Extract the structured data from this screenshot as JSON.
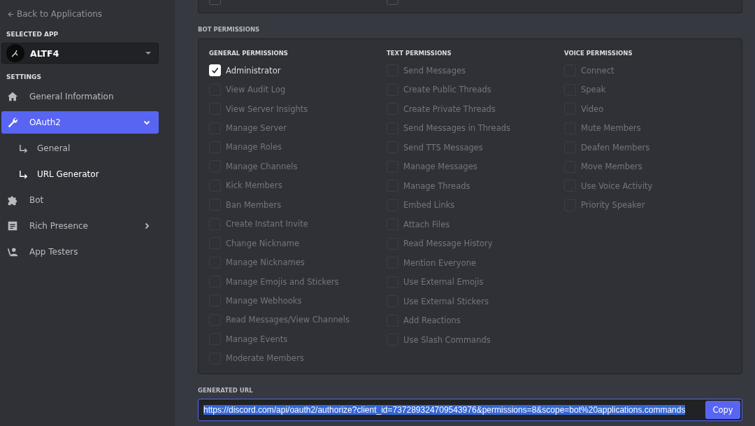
{
  "sidebar": {
    "back_link": "Back to Applications",
    "selected_app_label": "SELECTED APP",
    "app": {
      "name": "ALTF4"
    },
    "settings_label": "SETTINGS",
    "items": [
      {
        "label": "General Information",
        "kind": "link",
        "selected": false
      },
      {
        "label": "OAuth2",
        "kind": "group",
        "selected": true,
        "expanded": true,
        "children": [
          {
            "label": "General",
            "selected": false
          },
          {
            "label": "URL Generator",
            "selected": true
          }
        ]
      },
      {
        "label": "Bot",
        "kind": "link",
        "selected": false
      },
      {
        "label": "Rich Presence",
        "kind": "group",
        "selected": false,
        "expanded": false
      },
      {
        "label": "App Testers",
        "kind": "link",
        "selected": false
      }
    ]
  },
  "top_panel": {
    "checkboxes": [
      {
        "checked": false
      },
      {
        "checked": false
      }
    ]
  },
  "bot_permissions": {
    "title": "BOT PERMISSIONS",
    "columns": [
      {
        "title": "GENERAL PERMISSIONS",
        "items": [
          {
            "label": "Administrator",
            "checked": true,
            "disabled": false
          },
          {
            "label": "View Audit Log",
            "checked": false,
            "disabled": true
          },
          {
            "label": "View Server Insights",
            "checked": false,
            "disabled": true
          },
          {
            "label": "Manage Server",
            "checked": false,
            "disabled": true
          },
          {
            "label": "Manage Roles",
            "checked": false,
            "disabled": true
          },
          {
            "label": "Manage Channels",
            "checked": false,
            "disabled": true
          },
          {
            "label": "Kick Members",
            "checked": false,
            "disabled": true
          },
          {
            "label": "Ban Members",
            "checked": false,
            "disabled": true
          },
          {
            "label": "Create Instant Invite",
            "checked": false,
            "disabled": true
          },
          {
            "label": "Change Nickname",
            "checked": false,
            "disabled": true
          },
          {
            "label": "Manage Nicknames",
            "checked": false,
            "disabled": true
          },
          {
            "label": "Manage Emojis and Stickers",
            "checked": false,
            "disabled": true
          },
          {
            "label": "Manage Webhooks",
            "checked": false,
            "disabled": true
          },
          {
            "label": "Read Messages/View Channels",
            "checked": false,
            "disabled": true
          },
          {
            "label": "Manage Events",
            "checked": false,
            "disabled": true
          },
          {
            "label": "Moderate Members",
            "checked": false,
            "disabled": true
          }
        ]
      },
      {
        "title": "TEXT PERMISSIONS",
        "items": [
          {
            "label": "Send Messages",
            "checked": false,
            "disabled": true
          },
          {
            "label": "Create Public Threads",
            "checked": false,
            "disabled": true
          },
          {
            "label": "Create Private Threads",
            "checked": false,
            "disabled": true
          },
          {
            "label": "Send Messages in Threads",
            "checked": false,
            "disabled": true
          },
          {
            "label": "Send TTS Messages",
            "checked": false,
            "disabled": true
          },
          {
            "label": "Manage Messages",
            "checked": false,
            "disabled": true
          },
          {
            "label": "Manage Threads",
            "checked": false,
            "disabled": true
          },
          {
            "label": "Embed Links",
            "checked": false,
            "disabled": true
          },
          {
            "label": "Attach Files",
            "checked": false,
            "disabled": true
          },
          {
            "label": "Read Message History",
            "checked": false,
            "disabled": true
          },
          {
            "label": "Mention Everyone",
            "checked": false,
            "disabled": true
          },
          {
            "label": "Use External Emojis",
            "checked": false,
            "disabled": true
          },
          {
            "label": "Use External Stickers",
            "checked": false,
            "disabled": true
          },
          {
            "label": "Add Reactions",
            "checked": false,
            "disabled": true
          },
          {
            "label": "Use Slash Commands",
            "checked": false,
            "disabled": true
          }
        ]
      },
      {
        "title": "VOICE PERMISSIONS",
        "items": [
          {
            "label": "Connect",
            "checked": false,
            "disabled": true
          },
          {
            "label": "Speak",
            "checked": false,
            "disabled": true
          },
          {
            "label": "Video",
            "checked": false,
            "disabled": true
          },
          {
            "label": "Mute Members",
            "checked": false,
            "disabled": true
          },
          {
            "label": "Deafen Members",
            "checked": false,
            "disabled": true
          },
          {
            "label": "Move Members",
            "checked": false,
            "disabled": true
          },
          {
            "label": "Use Voice Activity",
            "checked": false,
            "disabled": true
          },
          {
            "label": "Priority Speaker",
            "checked": false,
            "disabled": true
          }
        ]
      }
    ]
  },
  "generated_url": {
    "title": "GENERATED URL",
    "value": "https://discord.com/api/oauth2/authorize?client_id=737289324709543976&permissions=8&scope=bot%20applications.commands",
    "text_selected": true,
    "button": "Copy"
  }
}
